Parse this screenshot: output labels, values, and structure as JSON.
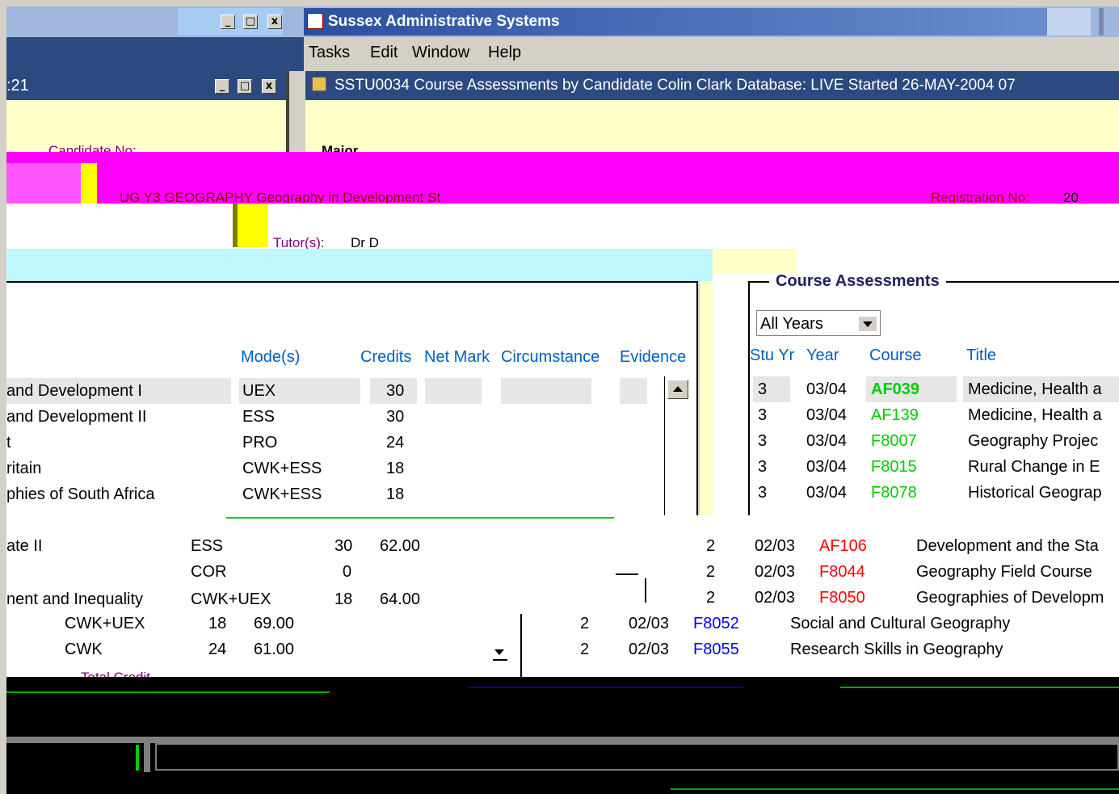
{
  "app": {
    "title": "Sussex Administrative Systems",
    "menu": [
      "Tasks",
      "Edit",
      "Window",
      "Help"
    ]
  },
  "left_window": {
    "title_fragment": ":21"
  },
  "form_window": {
    "title": "SSTU0034  Course Assessments by Candidate  Colin Clark  Database: LIVE  Started 26-MAY-2004 07",
    "candidate_fragment": "Candidate No:",
    "major_fragment": "Major",
    "programme": "UG Y3 GEOGRAPHY  Geography in Development St",
    "registration_label": "Registration No:",
    "registration_fragment": "20",
    "tutor_label": "Tutor(s):",
    "tutor_fragment": "Dr D"
  },
  "left_table": {
    "headers": {
      "mode": "Mode(s)",
      "credits": "Credits",
      "net_mark": "Net Mark",
      "circumstance": "Circumstance",
      "evidence": "Evidence"
    },
    "rows": [
      {
        "title": "and Development I",
        "mode": "UEX",
        "credits": "30",
        "mark": ""
      },
      {
        "title": "and Development II",
        "mode": "ESS",
        "credits": "30",
        "mark": ""
      },
      {
        "title": "t",
        "mode": "PRO",
        "credits": "24",
        "mark": ""
      },
      {
        "title": "ritain",
        "mode": "CWK+ESS",
        "credits": "18",
        "mark": ""
      },
      {
        "title": "phies of South Africa",
        "mode": "CWK+ESS",
        "credits": "18",
        "mark": ""
      }
    ],
    "shifted_rows": [
      {
        "title": "ate II",
        "mode": "ESS",
        "credits": "30",
        "mark": "62.00"
      },
      {
        "title": "",
        "mode": "COR",
        "credits": "0",
        "mark": ""
      },
      {
        "title": "nent and Inequality",
        "mode": "CWK+UEX",
        "credits": "18",
        "mark": "64.00"
      }
    ],
    "shifted_rows_2": [
      {
        "mode": "CWK+UEX",
        "credits": "18",
        "mark": "69.00"
      },
      {
        "mode": "CWK",
        "credits": "24",
        "mark": "61.00"
      }
    ],
    "total_fragment": "Total Credit"
  },
  "course_assessments": {
    "group_title": "Course Assessments",
    "filter_value": "All Years",
    "headers": {
      "stu_yr": "Stu Yr",
      "year": "Year",
      "course": "Course",
      "title": "Title"
    },
    "rows": [
      {
        "stu_yr": "3",
        "year": "03/04",
        "course": "AF039",
        "title": "Medicine, Health a"
      },
      {
        "stu_yr": "3",
        "year": "03/04",
        "course": "AF139",
        "title": "Medicine, Health a"
      },
      {
        "stu_yr": "3",
        "year": "03/04",
        "course": "F8007",
        "title": "Geography Projec"
      },
      {
        "stu_yr": "3",
        "year": "03/04",
        "course": "F8015",
        "title": "Rural Change in E"
      },
      {
        "stu_yr": "3",
        "year": "03/04",
        "course": "F8078",
        "title": "Historical Geograp"
      }
    ],
    "shifted_rows": [
      {
        "stu_yr": "2",
        "year": "02/03",
        "course": "AF106",
        "title": "Development and the Sta"
      },
      {
        "stu_yr": "2",
        "year": "02/03",
        "course": "F8044",
        "title": "Geography Field Course"
      },
      {
        "stu_yr": "2",
        "year": "02/03",
        "course": "F8050",
        "title": "Geographies of Developm"
      }
    ],
    "shifted_rows_2": [
      {
        "stu_yr": "2",
        "year": "02/03",
        "course": "F8052",
        "title": "Social and Cultural Geography"
      },
      {
        "stu_yr": "2",
        "year": "02/03",
        "course": "F8055",
        "title": "Research Skills in Geography"
      }
    ]
  },
  "colors": {
    "titlebar": "#9fb7dd",
    "magenta": "#ff00ff",
    "yellow": "#ffff00",
    "cyan": "#bff8ff",
    "green": "#00dd00",
    "red": "#ff0000",
    "blue": "#0000ff"
  },
  "window_buttons": {
    "minimize": "_",
    "maximize": "□",
    "close": "x"
  }
}
